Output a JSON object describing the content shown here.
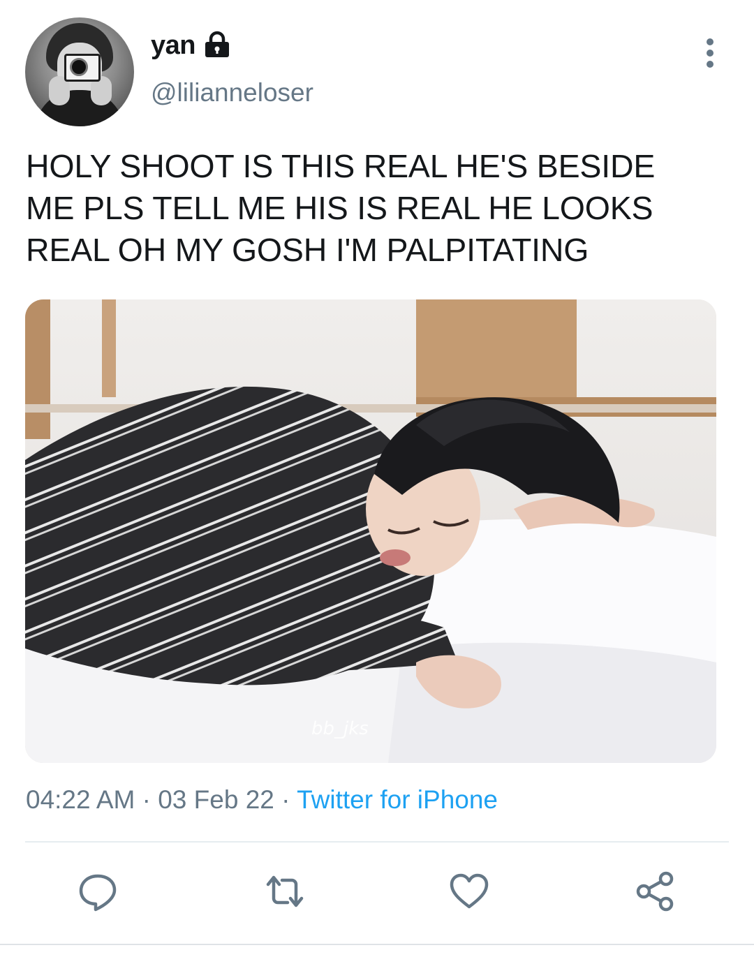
{
  "user": {
    "display_name": "yan",
    "handle": "@lilianneloser",
    "protected_icon": "lock-icon",
    "avatar_icon": "avatar"
  },
  "tweet": {
    "text": "HOLY SHOOT IS THIS REAL HE'S BESIDE\nME PLS TELL ME HIS IS REAL HE LOOKS\nREAL OH MY GOSH I'M PALPITATING",
    "media": {
      "description_icon": "photo",
      "watermark": "bb_jks"
    },
    "time": "04:22 AM",
    "date": "03 Feb 22",
    "separator": " · ",
    "source": "Twitter for iPhone"
  },
  "menu_icon": "more-vertical-icon",
  "actions": [
    {
      "icon": "reply-icon"
    },
    {
      "icon": "retweet-icon"
    },
    {
      "icon": "like-icon"
    },
    {
      "icon": "share-icon"
    }
  ],
  "colors": {
    "text": "#14171a",
    "secondary": "#657786",
    "link": "#1da1f2",
    "divider": "#e6ecf0"
  }
}
